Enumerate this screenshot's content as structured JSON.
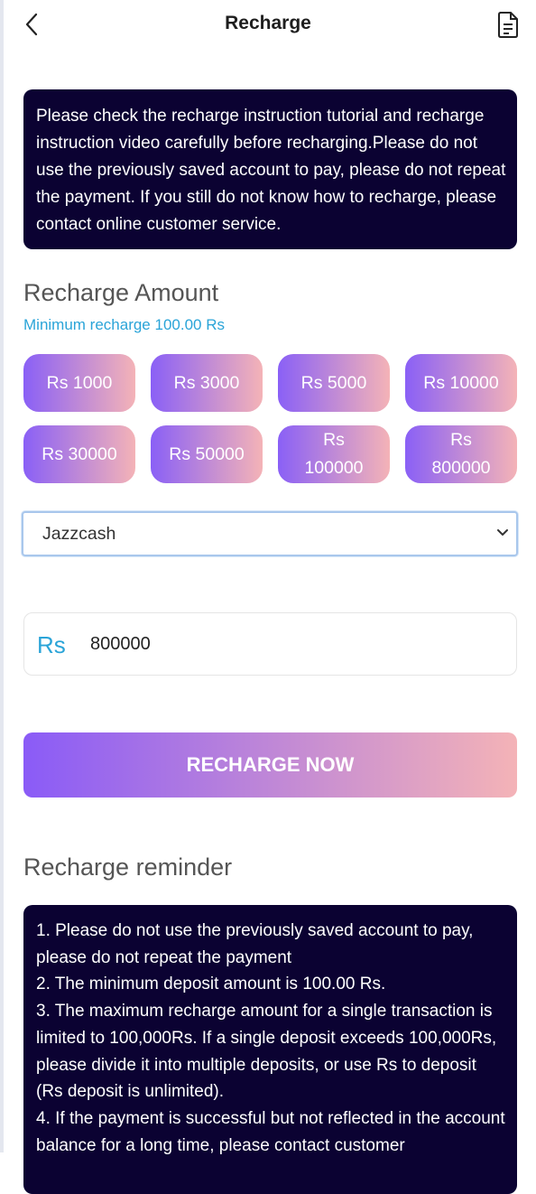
{
  "header": {
    "title": "Recharge",
    "back_icon": "chevron-left-icon",
    "doc_icon": "document-icon"
  },
  "notice": {
    "text": "Please check the recharge instruction tutorial and recharge instruction video carefully before recharging.Please do not use the previously saved account to pay, please do not repeat the payment. If you still do not know how to recharge, please contact online customer service."
  },
  "amount": {
    "title": "Recharge Amount",
    "minimum": "Minimum recharge 100.00 Rs",
    "options": [
      "Rs 1000",
      "Rs 3000",
      "Rs 5000",
      "Rs 10000",
      "Rs 30000",
      "Rs 50000",
      "Rs 100000",
      "Rs 800000"
    ]
  },
  "payment": {
    "selected": "Jazzcash"
  },
  "input": {
    "prefix": "Rs",
    "value": "800000"
  },
  "cta": {
    "label": "RECHARGE NOW"
  },
  "reminder": {
    "title": "Recharge reminder",
    "lines": [
      "1. Please do not use the previously saved account to pay, please do not repeat the payment",
      "2. The minimum deposit amount is 100.00 Rs.",
      "3. The maximum recharge amount for a single transaction is limited to 100,000Rs. If a single deposit exceeds 100,000Rs, please divide it into multiple deposits, or use Rs to deposit (Rs deposit is unlimited).",
      "4. If the payment is successful but not reflected in the account balance for a long time, please contact customer"
    ]
  },
  "colors": {
    "accent_blue": "#2aa4d8",
    "dark_panel": "#0b0232",
    "gradient_start": "#8a60f6",
    "gradient_end": "#f4b3b7"
  }
}
